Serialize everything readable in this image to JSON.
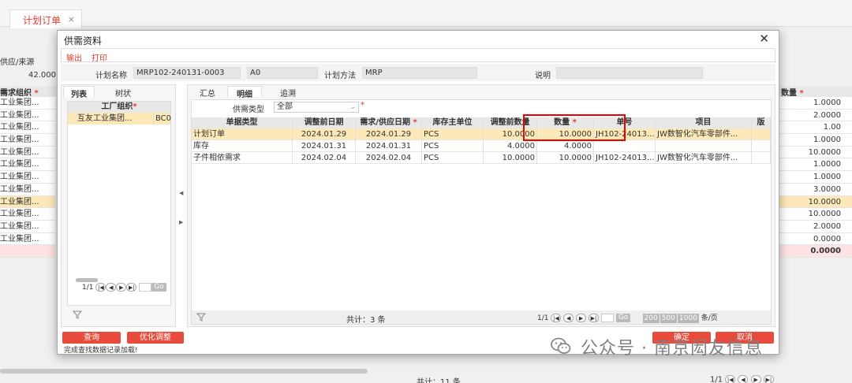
{
  "background": {
    "tab_label": "计划订单",
    "tab_close": "×",
    "supply_source_label": "供应/来源",
    "qty_value": "42.000",
    "left_header": "需求组织",
    "left_header_star": "*",
    "left_rows": [
      "工业集团...",
      "工业集团...",
      "工业集团...",
      "工业集团...",
      "工业集团...",
      "工业集团...",
      "工业集团...",
      "工业集团...",
      "工业集团...",
      "工业集团...",
      "工业集团...",
      "工业集团..."
    ],
    "right_header": "数量",
    "right_header_star": "*",
    "right_values": [
      "1.0000",
      "2.0000",
      "1.00",
      "1.0000",
      "10.0000",
      "1.0000",
      "1.0000",
      "3.0000",
      "10.0000",
      "10.0000",
      "2.0000",
      "0.0000",
      "0.0000"
    ],
    "total_text": "共计：11 条",
    "pager_text": "1/1"
  },
  "dialog": {
    "title": "供需资料",
    "close": "✕",
    "toolbar": {
      "export": "输出",
      "print": "打印"
    },
    "form": {
      "plan_name_label": "计划名称",
      "plan_name_value": "MRP102-240131-0003",
      "plan_version": "A0",
      "plan_method_label": "计划方法",
      "plan_method_value": "MRP",
      "remark_label": "说明",
      "remark_value": ""
    },
    "left": {
      "tab_list": "列表",
      "tab_tree": "树状",
      "header": "工厂组织",
      "header_star": "*",
      "row_name": "互友工业集团...",
      "row_code": "BC0",
      "pager": "1/1",
      "go": "Go"
    },
    "right": {
      "tab_summary": "汇总",
      "tab_detail": "明细",
      "tab_trace": "追溯",
      "filter_label": "供需类型",
      "filter_value": "全部",
      "filter_star": "*",
      "columns": [
        "单据类型",
        "调整前日期",
        "需求/供应日期",
        "库存主单位",
        "调整前数量",
        "数量",
        "单号",
        "项目",
        "版"
      ],
      "rows": [
        [
          "计划订单",
          "2024.01.29",
          "2024.01.29",
          "PCS",
          "10.0000",
          "10.0000",
          "JH102-24013...",
          "JW数智化汽车零部件..."
        ],
        [
          "库存",
          "2024.01.31",
          "2024.01.31",
          "PCS",
          "4.0000",
          "4.0000",
          "",
          ""
        ],
        [
          "子件相依需求",
          "2024.02.04",
          "2024.02.04",
          "PCS",
          "10.0000",
          "10.0000",
          "JH102-24013...",
          "JW数智化汽车零部件..."
        ]
      ],
      "total": "共计：3 条",
      "pager": "1/1",
      "go": "Go",
      "page_sizes": [
        "200",
        "500",
        "1000"
      ],
      "per_page": "条/页"
    },
    "buttons": {
      "query": "查询",
      "optimize": "优化调整",
      "confirm": "确定",
      "cancel": "取消"
    },
    "status": "完成查找数据记录加载!"
  },
  "watermark": "公众号 · 南京闳友信息",
  "colors": {
    "accent": "#e03c2d",
    "highlight": "#fde9b8",
    "redbox": "#ee0000"
  }
}
